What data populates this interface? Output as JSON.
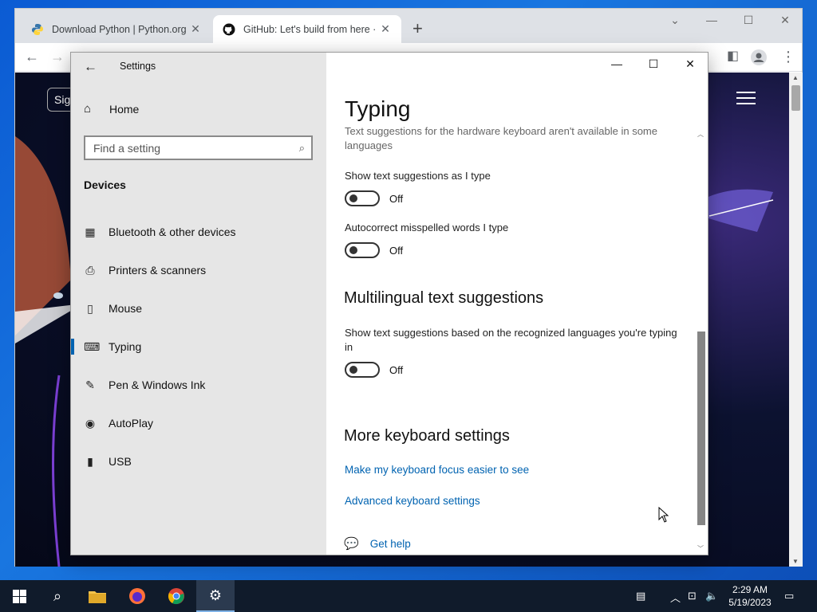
{
  "browser": {
    "tabs": [
      {
        "title": "Download Python | Python.org",
        "icon": "python-icon"
      },
      {
        "title": "GitHub: Let's build from here · Gi",
        "icon": "github-icon"
      }
    ],
    "new_tab": "+",
    "web": {
      "sign_button": "Sig"
    }
  },
  "settings": {
    "app_title": "Settings",
    "home_label": "Home",
    "search_placeholder": "Find a setting",
    "section": "Devices",
    "nav": [
      {
        "label": "Bluetooth & other devices",
        "icon": "bluetooth-devices-icon"
      },
      {
        "label": "Printers & scanners",
        "icon": "printer-icon"
      },
      {
        "label": "Mouse",
        "icon": "mouse-icon"
      },
      {
        "label": "Typing",
        "icon": "keyboard-icon",
        "selected": true
      },
      {
        "label": "Pen & Windows Ink",
        "icon": "pen-icon"
      },
      {
        "label": "AutoPlay",
        "icon": "autoplay-icon"
      },
      {
        "label": "USB",
        "icon": "usb-icon"
      }
    ],
    "page": {
      "title": "Typing",
      "truncated_text": "Text suggestions for the hardware keyboard aren't available in some languages",
      "opt1_label": "Show text suggestions as I type",
      "opt1_state": "Off",
      "opt2_label": "Autocorrect misspelled words I type",
      "opt2_state": "Off",
      "multilingual_heading": "Multilingual text suggestions",
      "opt3_label": "Show text suggestions based on the recognized languages you're typing in",
      "opt3_state": "Off",
      "more_heading": "More keyboard settings",
      "link1": "Make my keyboard focus easier to see",
      "link2": "Advanced keyboard settings",
      "help_label": "Get help"
    }
  },
  "taskbar": {
    "time": "2:29 AM",
    "date": "5/19/2023"
  },
  "colors": {
    "accent": "#0063b1",
    "taskbar": "#101b2b"
  }
}
